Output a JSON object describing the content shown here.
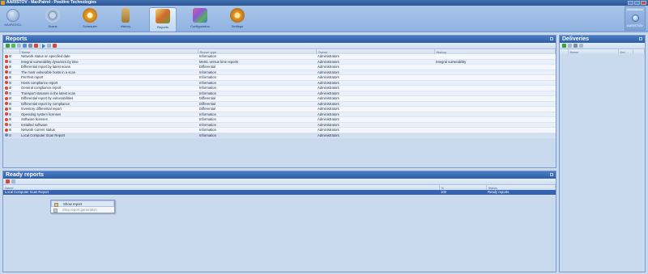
{
  "window": {
    "title": "AARISTOV - MaxPatrol - Positive Technologies"
  },
  "brand": {
    "name": "MAXPATROL"
  },
  "tabs": [
    {
      "label": "Scans"
    },
    {
      "label": "Scheduler"
    },
    {
      "label": "History"
    },
    {
      "label": "Reports"
    },
    {
      "label": "Configuration"
    },
    {
      "label": "Settings"
    }
  ],
  "user": {
    "header": "Administrator",
    "name": "AARISTOV"
  },
  "reports": {
    "title": "Reports",
    "columns": [
      "Name",
      "Report type",
      "Owner",
      "History"
    ],
    "rows": [
      {
        "name": "Network status on specified date",
        "type": "Information",
        "owner": "Administrators",
        "history": ""
      },
      {
        "name": "Integral vulnerability dynamics by time",
        "type": "Metric versus time reports",
        "owner": "Administrators",
        "history": "Integral vulnerability"
      },
      {
        "name": "Differential report by latest scans",
        "type": "Differential",
        "owner": "Administrators",
        "history": ""
      },
      {
        "name": "The most vulnerable hosts in a scan",
        "type": "Information",
        "owner": "Administrators",
        "history": ""
      },
      {
        "name": "PenTest report",
        "type": "Information",
        "owner": "Administrators",
        "history": ""
      },
      {
        "name": "Hosts compliance report",
        "type": "Information",
        "owner": "Administrators",
        "history": ""
      },
      {
        "name": "General compliance report",
        "type": "Information",
        "owner": "Administrators",
        "history": ""
      },
      {
        "name": "Transport statuses in the latest scan",
        "type": "Information",
        "owner": "Administrators",
        "history": ""
      },
      {
        "name": "Differential report by vulnerabilities",
        "type": "Differential",
        "owner": "Administrators",
        "history": ""
      },
      {
        "name": "Differential report by compliance",
        "type": "Differential",
        "owner": "Administrators",
        "history": ""
      },
      {
        "name": "Inventory differential report",
        "type": "Differential",
        "owner": "Administrators",
        "history": ""
      },
      {
        "name": "Operating system licenses",
        "type": "Information",
        "owner": "Administrators",
        "history": ""
      },
      {
        "name": "Software licenses",
        "type": "Information",
        "owner": "Administrators",
        "history": ""
      },
      {
        "name": "Installed software",
        "type": "Information",
        "owner": "Administrators",
        "history": ""
      },
      {
        "name": "Network current status",
        "type": "Information",
        "owner": "Administrators",
        "history": ""
      },
      {
        "name": "Local Computer Scan Report",
        "type": "Information",
        "owner": "Administrators",
        "history": ""
      }
    ]
  },
  "ready": {
    "title": "Ready reports",
    "columns": [
      "Name",
      "%",
      "Status"
    ],
    "rows": [
      {
        "name": "Local Computer Scan Report",
        "pct": "100",
        "status": "Ready reports"
      }
    ]
  },
  "deliveries": {
    "title": "Deliveries",
    "columns": [
      "Name",
      "Del..."
    ]
  },
  "context_menu": {
    "items": [
      {
        "label": "Show report"
      },
      {
        "label": "Stop report generation"
      }
    ]
  }
}
